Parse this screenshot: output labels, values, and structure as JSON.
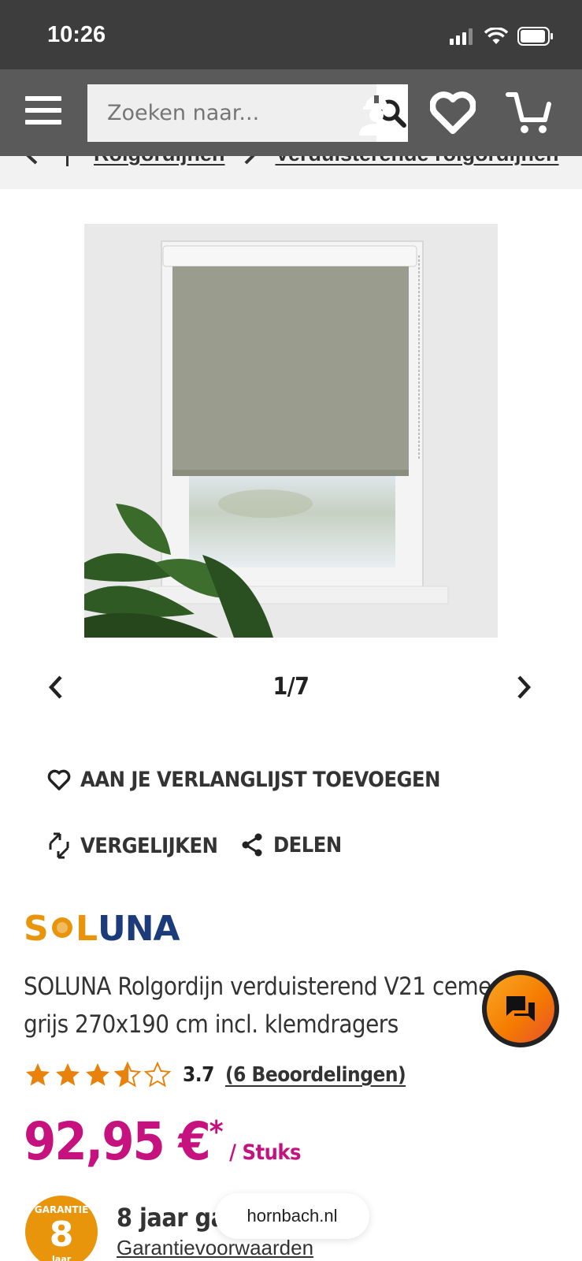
{
  "status_bar": {
    "time": "10:26"
  },
  "header": {
    "search_placeholder": "Zoeken naar..."
  },
  "breadcrumb": {
    "items": [
      "Rolgordijnen",
      "Verduisterende rolgordijnen"
    ]
  },
  "gallery": {
    "counter": "1/7"
  },
  "actions": {
    "wishlist": "AAN JE VERLANGLIJST TOEVOEGEN",
    "compare": "VERGELIJKEN",
    "share": "DELEN"
  },
  "product": {
    "brand": "SOLUNA",
    "title": "SOLUNA Rolgordijn verduisterend V21 cement grijs 270x190 cm incl. klemdragers",
    "rating": {
      "value": 3.7,
      "value_text": "3.7",
      "reviews": "(6 Beoordelingen)",
      "max": 5
    },
    "price": {
      "amount": "92,95 €",
      "asterisk": "*",
      "unit": "/ Stuks"
    }
  },
  "guarantee": {
    "badge_top": "GARANTIE",
    "badge_number": "8",
    "badge_bottom": "Jaar",
    "text": "8 jaar garantie",
    "link": "Garantievoorwaarden"
  },
  "browser": {
    "url": "hornbach.nl"
  },
  "colors": {
    "header": "#5a5a5a",
    "price": "#c5127f",
    "star": "#e8820c",
    "brand_orange": "#e8950c",
    "brand_navy": "#1c3b7a"
  }
}
